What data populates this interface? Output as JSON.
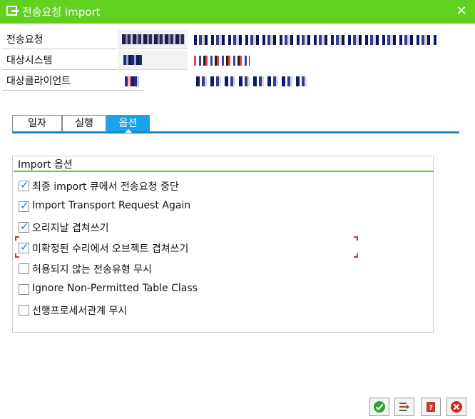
{
  "window": {
    "title": "전송요청 import",
    "close_glyph": "✕"
  },
  "fields": [
    {
      "label": "전송요청"
    },
    {
      "label": "대상시스템"
    },
    {
      "label": "대상클라이언트"
    }
  ],
  "tabs": [
    {
      "label": "일자"
    },
    {
      "label": "실행"
    },
    {
      "label": "옵션",
      "active": true
    }
  ],
  "import_options": {
    "title": "Import 옵션",
    "items": [
      {
        "label": "최종 import 큐에서 전송요청 중단",
        "checked": true
      },
      {
        "label": "Import Transport Request Again",
        "checked": true
      },
      {
        "label": "오리지날 겹쳐쓰기",
        "checked": true
      },
      {
        "label": "미확정된 수리에서 오브젝트 겹쳐쓰기",
        "checked": true,
        "focused": true
      },
      {
        "label": "허용되지 않는 전송유형 무시",
        "checked": false
      },
      {
        "label": "Ignore Non-Permitted Table Class",
        "checked": false
      },
      {
        "label": "선행프로세서관계 무시",
        "checked": false
      }
    ]
  },
  "footer_buttons": [
    {
      "icon": "confirm-check-icon",
      "color": "#2ea12e"
    },
    {
      "icon": "import-queue-icon",
      "color": "#c0392b"
    },
    {
      "icon": "help-book-icon",
      "color": "#c0392b"
    },
    {
      "icon": "cancel-x-icon",
      "color": "#d9231d"
    }
  ],
  "colors": {
    "titlebar": "#5fd11e",
    "tab_active": "#1aa3e8",
    "group_accent": "#5fd11e"
  }
}
